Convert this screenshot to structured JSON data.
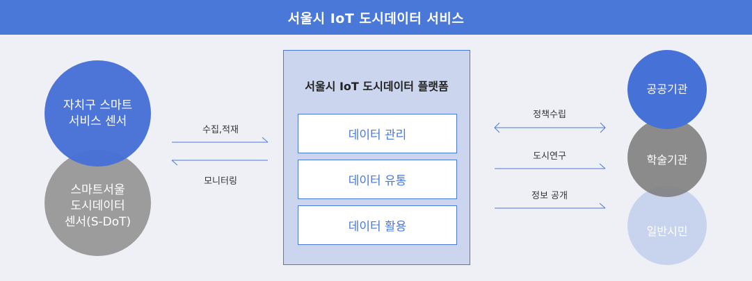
{
  "header": {
    "title": "서울시 IoT 도시데이터 서비스"
  },
  "left": {
    "top_circle": {
      "line1": "자치구 스마트",
      "line2": "서비스 센서"
    },
    "bottom_circle": {
      "line1": "스마트서울",
      "line2": "도시데이터",
      "line3": "센서(S-DoT)"
    },
    "arrow_in_label": "수집,적재",
    "arrow_out_label": "모니터링"
  },
  "platform": {
    "title": "서울시 IoT 도시데이터 플랫폼",
    "boxes": [
      "데이터 관리",
      "데이터 유통",
      "데이터 활용"
    ]
  },
  "right": {
    "arrows": [
      "정책수립",
      "도시연구",
      "정보 공개"
    ],
    "circles": [
      "공공기관",
      "학술기관",
      "일반시민"
    ]
  },
  "colors": {
    "accent": "#4a78d9",
    "gray": "#9c9c9c",
    "light_blue": "#c8d3ee",
    "background": "#eef0f5"
  }
}
